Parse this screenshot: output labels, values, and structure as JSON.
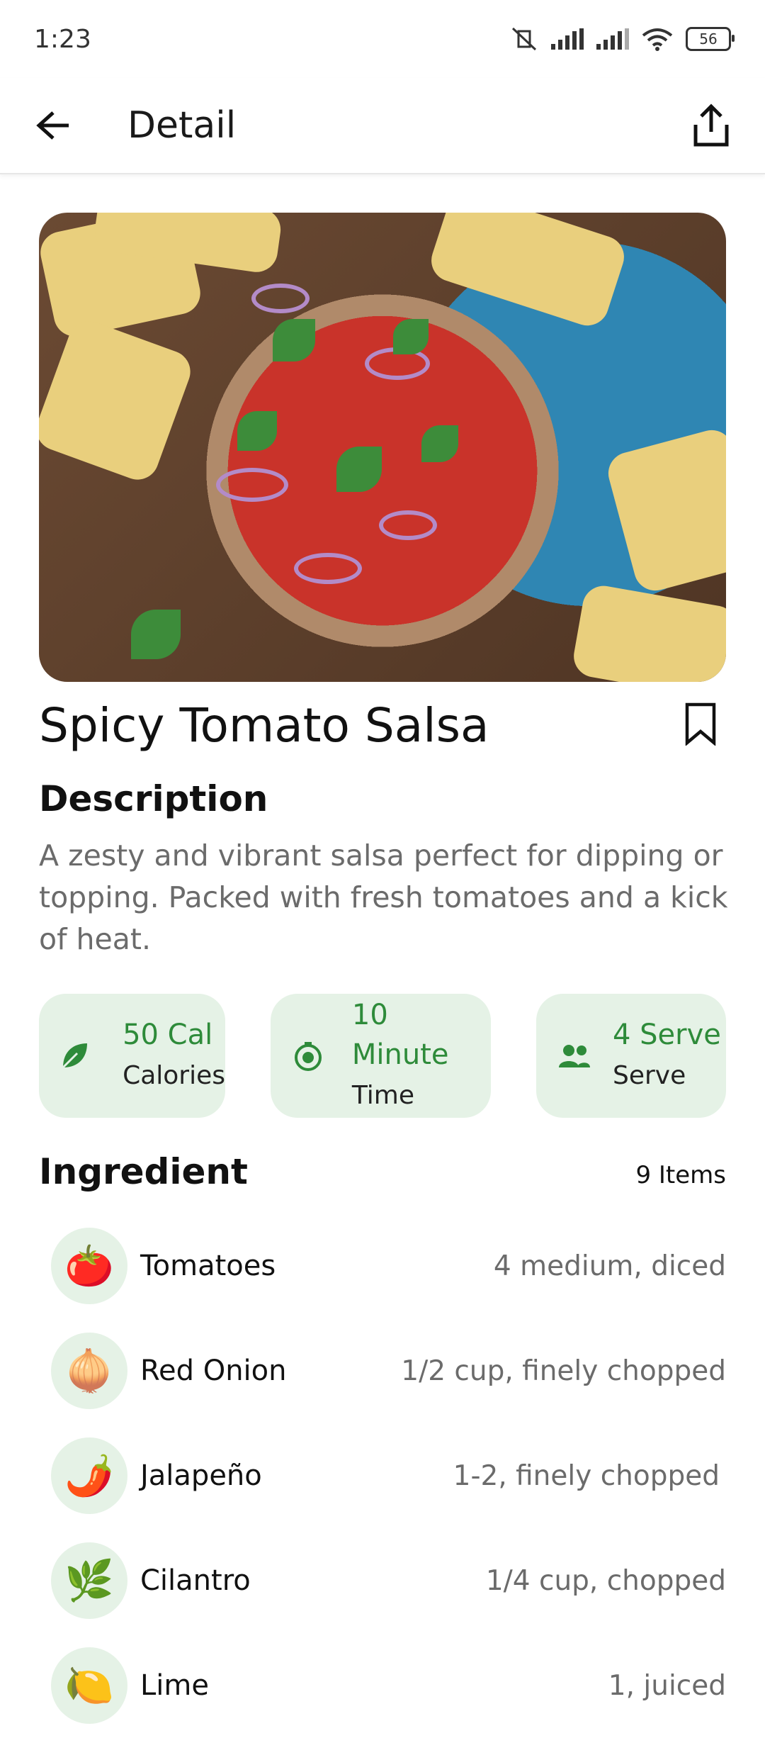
{
  "status": {
    "time": "1:23",
    "battery": "56"
  },
  "appbar": {
    "title": "Detail",
    "back_icon": "arrow-left-icon",
    "share_icon": "share-icon"
  },
  "recipe": {
    "title": "Spicy Tomato Salsa",
    "description_heading": "Description",
    "description": "A zesty and vibrant salsa perfect for dipping or topping. Packed with fresh tomatoes and a kick of heat."
  },
  "stats": [
    {
      "value": "50 Cal",
      "label": "Calories",
      "icon": "leaf-icon"
    },
    {
      "value": "10 Minute",
      "label": "Time",
      "icon": "timer-icon"
    },
    {
      "value": "4 Serve",
      "label": "Serve",
      "icon": "people-icon"
    }
  ],
  "ingredients": {
    "heading": "Ingredient",
    "count": "9 Items",
    "items": [
      {
        "emoji": "🍅",
        "name": "Tomatoes",
        "amount": "4 medium, diced"
      },
      {
        "emoji": "🧅",
        "name": "Red Onion",
        "amount": "1/2 cup, finely chopped"
      },
      {
        "emoji": "🌶️",
        "name": "Jalapeño",
        "amount": "1-2, finely chopped"
      },
      {
        "emoji": "🌿",
        "name": "Cilantro",
        "amount": "1/4 cup, chopped"
      },
      {
        "emoji": "🍋",
        "name": "Lime",
        "amount": "1, juiced"
      }
    ]
  },
  "colors": {
    "accent_green": "#2e8b3a",
    "card_bg": "#e5f2e6",
    "muted_text": "#6b6b6b"
  }
}
